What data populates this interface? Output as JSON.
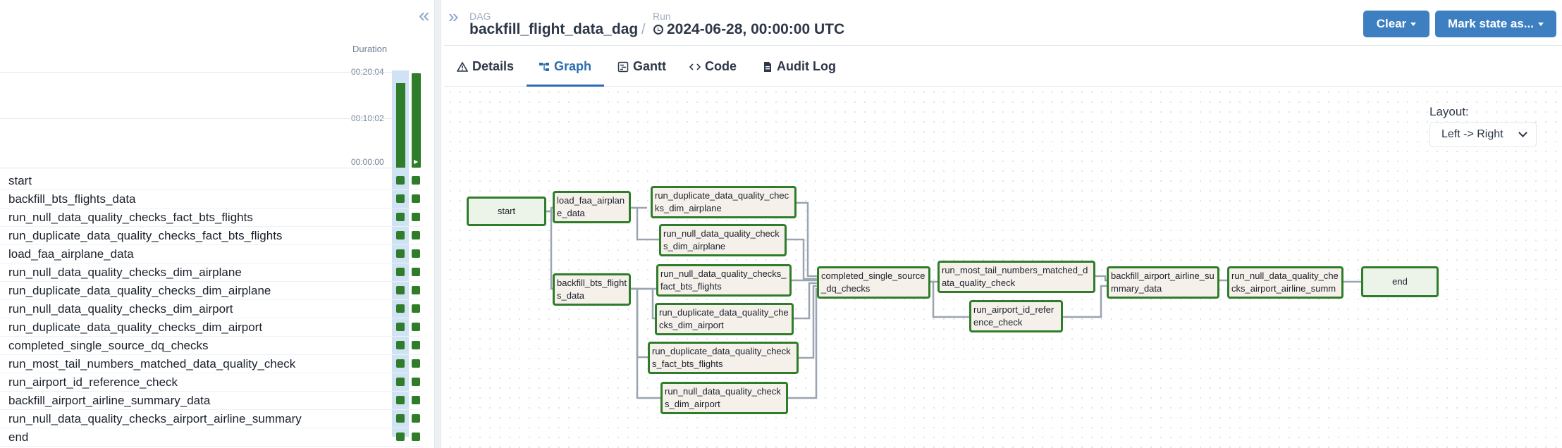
{
  "sidebar": {
    "duration_label": "Duration",
    "ticks": [
      "00:20:04",
      "00:10:02",
      "00:00:00"
    ],
    "tasks": [
      "start",
      "backfill_bts_flights_data",
      "run_null_data_quality_checks_fact_bts_flights",
      "run_duplicate_data_quality_checks_fact_bts_flights",
      "load_faa_airplane_data",
      "run_null_data_quality_checks_dim_airplane",
      "run_duplicate_data_quality_checks_dim_airplane",
      "run_null_data_quality_checks_dim_airport",
      "run_duplicate_data_quality_checks_dim_airport",
      "completed_single_source_dq_checks",
      "run_most_tail_numbers_matched_data_quality_check",
      "run_airport_id_reference_check",
      "backfill_airport_airline_summary_data",
      "run_null_data_quality_checks_airport_airline_summary",
      "end"
    ],
    "status_color": "#2f7d2a"
  },
  "header": {
    "dag_label": "DAG",
    "dag_id": "backfill_flight_data_dag",
    "separator": "/",
    "run_label": "Run",
    "run_id": "2024-06-28, 00:00:00 UTC",
    "clear_button": "Clear",
    "mark_state_button": "Mark state as..."
  },
  "tabs": [
    {
      "label": "Details",
      "icon": "warning-triangle-icon"
    },
    {
      "label": "Graph",
      "icon": "graph-icon",
      "active": true
    },
    {
      "label": "Gantt",
      "icon": "gantt-icon"
    },
    {
      "label": "Code",
      "icon": "code-icon"
    },
    {
      "label": "Audit Log",
      "icon": "file-icon"
    }
  ],
  "graph": {
    "layout_label": "Layout:",
    "layout_value": "Left -> Right",
    "nodes": {
      "start": "start",
      "load_faa": "load_faa_airplane_data",
      "backfill_bts": "backfill_bts_flights_data",
      "dup_dim_airplane": "run_duplicate_data_quality_checks_dim_airplane",
      "null_dim_airplane": "run_null_data_quality_checks_dim_airplane",
      "null_fact_bts": "run_null_data_quality_checks_fact_bts_flights",
      "dup_dim_airport": "run_duplicate_data_quality_checks_dim_airport",
      "dup_fact_bts": "run_duplicate_data_quality_checks_fact_bts_flights",
      "null_dim_airport": "run_null_data_quality_checks_dim_airport",
      "completed": "completed_single_source_dq_checks",
      "most_tail": "run_most_tail_numbers_matched_data_quality_check",
      "airport_ref": "run_airport_id_reference_check",
      "backfill_summary": "backfill_airport_airline_summary_data",
      "null_summary": "run_null_data_quality_checks_airport_airline_summary",
      "end": "end"
    },
    "success_color": "#2f7d2a",
    "edge_color": "#9aa5b1"
  }
}
